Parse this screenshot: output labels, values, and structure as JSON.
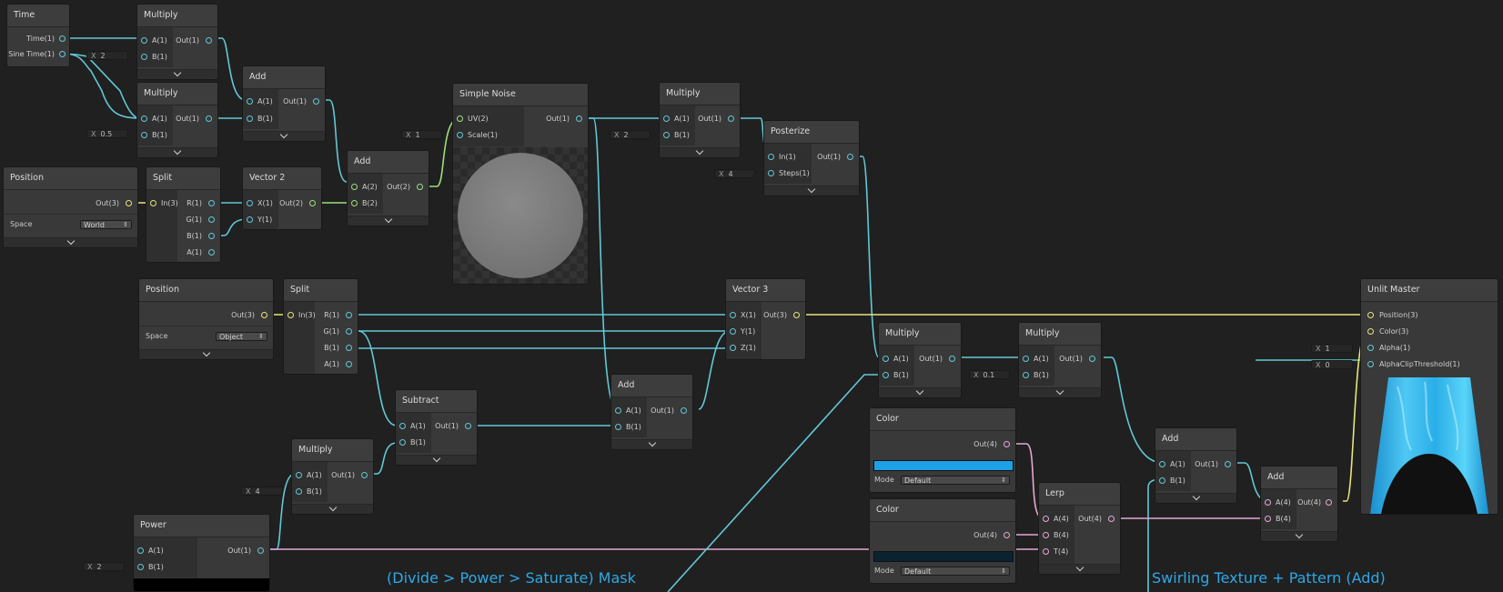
{
  "colors": {
    "canvas": "#202020",
    "wire_float": "#62c8d6",
    "wire_vec2": "#9be07a",
    "wire_vec3": "#e6e67a",
    "wire_vec4": "#e6a8d4",
    "caption": "#2ea8e6",
    "color_swatch_1": "#1ea0e6",
    "color_swatch_2": "#0b2230"
  },
  "nodes": {
    "time": {
      "title": "Time",
      "outputs": [
        "Time(1)",
        "Sine Time(1)"
      ]
    },
    "multiply_1": {
      "title": "Multiply",
      "inputs": [
        "A(1)",
        "B(1)"
      ],
      "output": "Out(1)",
      "b_value": "2"
    },
    "multiply_2": {
      "title": "Multiply",
      "inputs": [
        "A(1)",
        "B(1)"
      ],
      "output": "Out(1)",
      "b_value": "0.5"
    },
    "add_1": {
      "title": "Add",
      "inputs": [
        "A(1)",
        "B(1)"
      ],
      "output": "Out(1)"
    },
    "add_2": {
      "title": "Add",
      "inputs": [
        "A(2)",
        "B(2)"
      ],
      "output": "Out(2)"
    },
    "simple_noise": {
      "title": "Simple Noise",
      "inputs": [
        "UV(2)",
        "Scale(1)"
      ],
      "output": "Out(1)",
      "scale_value": "1"
    },
    "multiply_3": {
      "title": "Multiply",
      "inputs": [
        "A(1)",
        "B(1)"
      ],
      "output": "Out(1)",
      "b_value": "2"
    },
    "posterize": {
      "title": "Posterize",
      "inputs": [
        "In(1)",
        "Steps(1)"
      ],
      "output": "Out(1)",
      "steps_value": "4"
    },
    "position_1": {
      "title": "Position",
      "output": "Out(3)",
      "space_label": "Space",
      "space_value": "World"
    },
    "split_1": {
      "title": "Split",
      "input": "In(3)",
      "outputs": [
        "R(1)",
        "G(1)",
        "B(1)",
        "A(1)"
      ]
    },
    "vector2": {
      "title": "Vector 2",
      "inputs": [
        "X(1)",
        "Y(1)"
      ],
      "output": "Out(2)"
    },
    "position_2": {
      "title": "Position",
      "output": "Out(3)",
      "space_label": "Space",
      "space_value": "Object"
    },
    "split_2": {
      "title": "Split",
      "input": "In(3)",
      "outputs": [
        "R(1)",
        "G(1)",
        "B(1)",
        "A(1)"
      ]
    },
    "vector3": {
      "title": "Vector 3",
      "inputs": [
        "X(1)",
        "Y(1)",
        "Z(1)"
      ],
      "output": "Out(3)"
    },
    "add_3": {
      "title": "Add",
      "inputs": [
        "A(1)",
        "B(1)"
      ],
      "output": "Out(1)"
    },
    "subtract": {
      "title": "Subtract",
      "inputs": [
        "A(1)",
        "B(1)"
      ],
      "output": "Out(1)"
    },
    "multiply_4": {
      "title": "Multiply",
      "inputs": [
        "A(1)",
        "B(1)"
      ],
      "output": "Out(1)",
      "b_value": "4"
    },
    "power": {
      "title": "Power",
      "inputs": [
        "A(1)",
        "B(1)"
      ],
      "output": "Out(1)",
      "b_value": "2"
    },
    "multiply_5": {
      "title": "Multiply",
      "inputs": [
        "A(1)",
        "B(1)"
      ],
      "output": "Out(1)"
    },
    "multiply_6": {
      "title": "Multiply",
      "inputs": [
        "A(1)",
        "B(1)"
      ],
      "output": "Out(1)",
      "b_value": "0.1"
    },
    "color_1": {
      "title": "Color",
      "output": "Out(4)",
      "mode_label": "Mode",
      "mode_value": "Default"
    },
    "color_2": {
      "title": "Color",
      "output": "Out(4)",
      "mode_label": "Mode",
      "mode_value": "Default"
    },
    "lerp": {
      "title": "Lerp",
      "inputs": [
        "A(4)",
        "B(4)",
        "T(4)"
      ],
      "output": "Out(4)"
    },
    "add_4": {
      "title": "Add",
      "inputs": [
        "A(1)",
        "B(1)"
      ],
      "output": "Out(1)"
    },
    "add_5": {
      "title": "Add",
      "inputs": [
        "A(4)",
        "B(4)"
      ],
      "output": "Out(4)"
    },
    "unlit_master": {
      "title": "Unlit Master",
      "inputs": [
        "Position(3)",
        "Color(3)",
        "Alpha(1)",
        "AlphaClipThreshold(1)"
      ],
      "alpha_value": "1",
      "clip_value": "0"
    }
  },
  "field_prefix": "X",
  "captions": {
    "mask": "(Divide > Power > Saturate) Mask",
    "texture": "Swirling Texture + Pattern (Add)"
  }
}
